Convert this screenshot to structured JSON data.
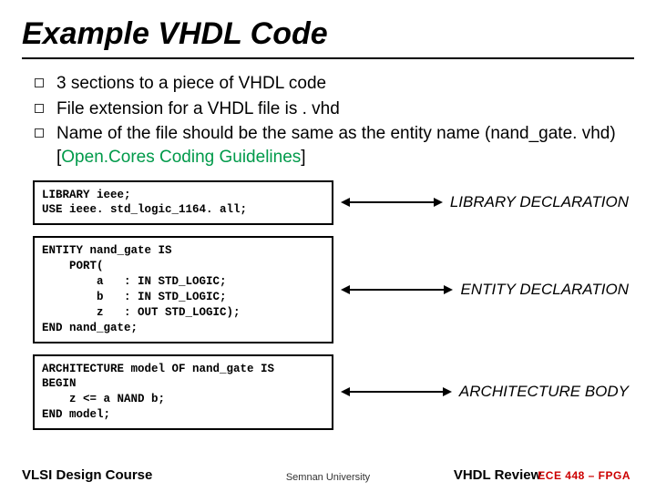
{
  "title": "Example VHDL Code",
  "bullets": {
    "b1": "3 sections to a piece of VHDL code",
    "b2": "File extension for a VHDL file is . vhd",
    "b3a": "Name of the file should be the same as the entity name (nand_gate. vhd) [",
    "b3b": "Open.Cores Coding Guidelines",
    "b3c": "]"
  },
  "code": {
    "lib": "LIBRARY ieee;\nUSE ieee. std_logic_1164. all;",
    "entity": "ENTITY nand_gate IS\n    PORT(\n        a   : IN STD_LOGIC;\n        b   : IN STD_LOGIC;\n        z   : OUT STD_LOGIC);\nEND nand_gate;",
    "arch": "ARCHITECTURE model OF nand_gate IS\nBEGIN\n    z <= a NAND b;\nEND model;"
  },
  "labels": {
    "lib": "LIBRARY DECLARATION",
    "entity": "ENTITY DECLARATION",
    "arch": "ARCHITECTURE BODY"
  },
  "footer": {
    "left": "VLSI Design Course",
    "center": "Semnan University",
    "right_main": "VHDL Review",
    "right_red": "ECE 448 – FPGA"
  }
}
